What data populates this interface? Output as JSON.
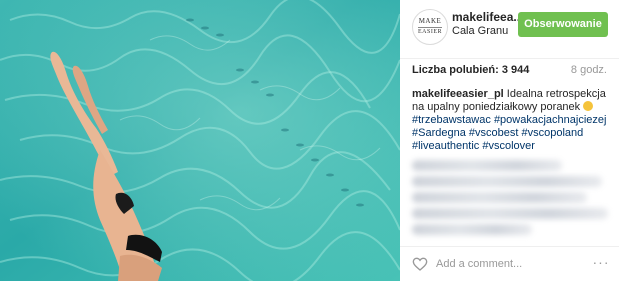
{
  "post": {
    "photo_icon": "swimmer-photo",
    "water_color": "#2fb8b0"
  },
  "header": {
    "avatar_text_top": "MAKE",
    "avatar_text_bottom": "EASIER",
    "username": "makelifeea...",
    "location": "Cala Granu",
    "follow_label": "Obserwowanie",
    "follow_color": "#70c050"
  },
  "stats": {
    "likes": "Liczba polubień: 3 944",
    "time": "8 godz."
  },
  "caption": {
    "user": "makelifeeasier_pl",
    "text": " Idealna retrospekcja na upalny poniedziałkowy poranek",
    "emoji": "sun-emoji",
    "tags": [
      "#trzebawstawac",
      "#powakacjachnajciezej",
      "#Sardegna",
      "#vscobest",
      "#vscopoland",
      "#liveauthentic",
      "#vscolover"
    ]
  },
  "footer": {
    "comment_placeholder": "Add a comment...",
    "more_label": "···",
    "heart_icon": "heart-icon"
  }
}
